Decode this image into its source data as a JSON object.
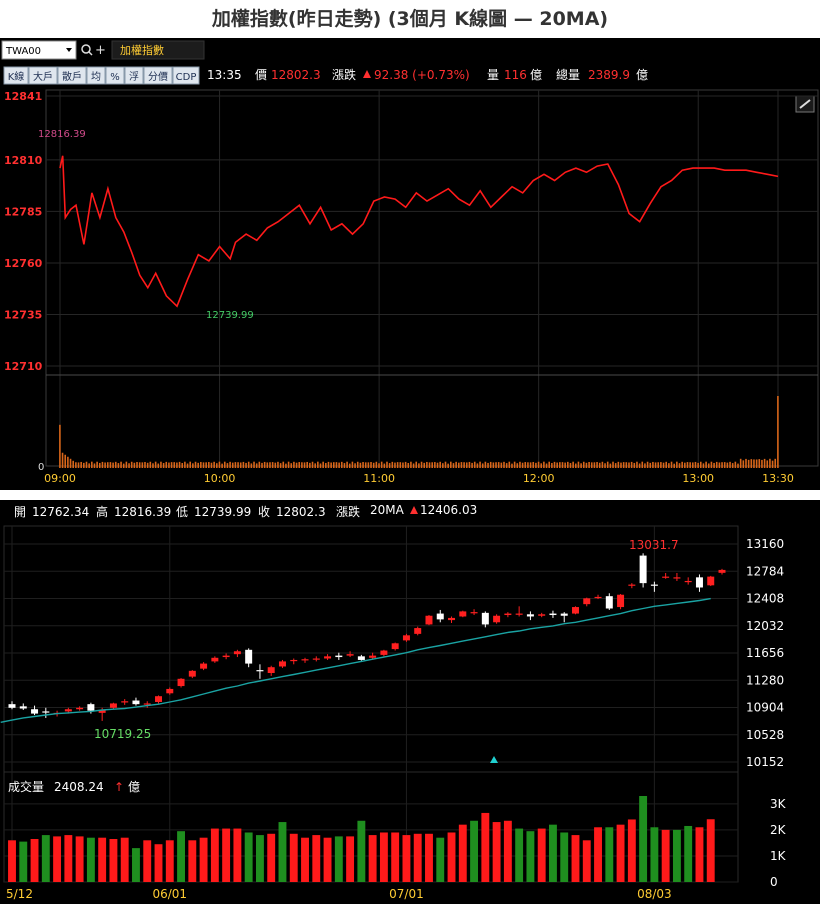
{
  "page_title": "加權指數(昨日走勢) (3個月 K線圖 — 20MA)",
  "intraday": {
    "symbol_value": "TWA00",
    "index_name": "加權指數",
    "toolbar_buttons": [
      "K線",
      "大戶",
      "散戶",
      "均",
      "%",
      "浮",
      "分價",
      "CDP"
    ],
    "time": "13:35",
    "price_label": "價",
    "price": "12802.3",
    "change_label": "漲跌",
    "change": "92.38 (+0.73%)",
    "volume_label": "量",
    "volume": "116",
    "volume_unit": "億",
    "total_label": "總量",
    "total": "2389.9",
    "total_unit": "億",
    "high_label": "12816.39",
    "low_label": "12739.99",
    "colors": {
      "line": "#ff1a1a",
      "volume": "#d9661a",
      "grid": "#2a2a2a",
      "up": "#ff2020"
    }
  },
  "kline": {
    "open_label": "開",
    "open": "12762.34",
    "high_label": "高",
    "high": "12816.39",
    "low_label": "低",
    "low": "12739.99",
    "close_label": "收",
    "close": "12802.3",
    "change_label": "漲跌",
    "ma_label": "20MA",
    "ma_value": "12406.03",
    "max_label": "13031.7",
    "min_label": "10719.25",
    "volume_title": "成交量",
    "volume_value": "2408.24",
    "volume_unit": "億",
    "colors": {
      "up": "#ff2020",
      "down": "#ffffff",
      "vol_up": "#ff1a1a",
      "vol_down": "#1f8f1f",
      "ma": "#1aa3a3"
    }
  },
  "chart_data": [
    {
      "type": "line",
      "title": "",
      "x_ticks": [
        "09:00",
        "10:00",
        "11:00",
        "12:00",
        "13:00",
        "13:30"
      ],
      "y_ticks": [
        12841,
        12810,
        12785,
        12760,
        12735,
        12710
      ],
      "ylim": [
        12710,
        12841
      ],
      "x_minutes": [
        0,
        1,
        2,
        4,
        6,
        9,
        12,
        15,
        18,
        21,
        24,
        27,
        30,
        33,
        36,
        40,
        44,
        48,
        52,
        56,
        60,
        64,
        66,
        70,
        74,
        78,
        82,
        86,
        90,
        94,
        98,
        102,
        106,
        110,
        114,
        118,
        122,
        126,
        130,
        134,
        138,
        142,
        146,
        150,
        154,
        158,
        162,
        166,
        170,
        174,
        178,
        182,
        186,
        190,
        194,
        198,
        202,
        206,
        210,
        214,
        218,
        222,
        226,
        230,
        234,
        238,
        242,
        246,
        250,
        254,
        258,
        262,
        266,
        270
      ],
      "y": [
        12806,
        12812,
        12782,
        12786,
        12788,
        12769,
        12794,
        12782,
        12796,
        12782,
        12775,
        12765,
        12754,
        12748,
        12755,
        12744,
        12739,
        12752,
        12764,
        12761,
        12768,
        12762,
        12770,
        12774,
        12771,
        12777,
        12780,
        12784,
        12788,
        12779,
        12787,
        12776,
        12779,
        12774,
        12779,
        12790,
        12792,
        12791,
        12787,
        12794,
        12790,
        12793,
        12796,
        12791,
        12788,
        12795,
        12787,
        12792,
        12797,
        12794,
        12800,
        12803,
        12800,
        12804,
        12806,
        12804,
        12807,
        12808,
        12798,
        12784,
        12780,
        12789,
        12797,
        12800,
        12805,
        12806,
        12806,
        12806,
        12805,
        12805,
        12805,
        12804,
        12803,
        12802
      ],
      "volume_first": 60,
      "volume_last": 100,
      "volume_typical": 8
    },
    {
      "type": "candlestick",
      "title": "",
      "x_ticks": [
        "5/12",
        "06/01",
        "07/01",
        "08/03"
      ],
      "y_ticks": [
        13160,
        12784,
        12408,
        12032,
        11656,
        11280,
        10904,
        10528,
        10152
      ],
      "ylim": [
        10050,
        13300
      ],
      "volume_ticks": [
        "3K",
        "2K",
        "1K",
        "0"
      ],
      "volume_max": 3300,
      "candles": [
        {
          "o": 10950,
          "h": 10990,
          "l": 10880,
          "c": 10900
        },
        {
          "o": 10920,
          "h": 10960,
          "l": 10870,
          "c": 10890
        },
        {
          "o": 10880,
          "h": 10930,
          "l": 10800,
          "c": 10820
        },
        {
          "o": 10850,
          "h": 10900,
          "l": 10760,
          "c": 10840
        },
        {
          "o": 10830,
          "h": 10860,
          "l": 10780,
          "c": 10830
        },
        {
          "o": 10850,
          "h": 10900,
          "l": 10820,
          "c": 10880
        },
        {
          "o": 10880,
          "h": 10920,
          "l": 10860,
          "c": 10900
        },
        {
          "o": 10950,
          "h": 10970,
          "l": 10820,
          "c": 10860
        },
        {
          "o": 10830,
          "h": 10900,
          "l": 10719,
          "c": 10870
        },
        {
          "o": 10900,
          "h": 10970,
          "l": 10880,
          "c": 10960
        },
        {
          "o": 10980,
          "h": 11020,
          "l": 10940,
          "c": 10990
        },
        {
          "o": 11000,
          "h": 11040,
          "l": 10930,
          "c": 10950
        },
        {
          "o": 10960,
          "h": 10990,
          "l": 10900,
          "c": 10960
        },
        {
          "o": 10980,
          "h": 11070,
          "l": 10960,
          "c": 11060
        },
        {
          "o": 11100,
          "h": 11180,
          "l": 11080,
          "c": 11160
        },
        {
          "o": 11200,
          "h": 11310,
          "l": 11180,
          "c": 11300
        },
        {
          "o": 11330,
          "h": 11420,
          "l": 11310,
          "c": 11410
        },
        {
          "o": 11440,
          "h": 11530,
          "l": 11420,
          "c": 11510
        },
        {
          "o": 11540,
          "h": 11610,
          "l": 11520,
          "c": 11590
        },
        {
          "o": 11600,
          "h": 11650,
          "l": 11570,
          "c": 11620
        },
        {
          "o": 11640,
          "h": 11700,
          "l": 11600,
          "c": 11680
        },
        {
          "o": 11700,
          "h": 11720,
          "l": 11460,
          "c": 11510
        },
        {
          "o": 11420,
          "h": 11500,
          "l": 11300,
          "c": 11410
        },
        {
          "o": 11380,
          "h": 11480,
          "l": 11340,
          "c": 11460
        },
        {
          "o": 11470,
          "h": 11560,
          "l": 11450,
          "c": 11540
        },
        {
          "o": 11550,
          "h": 11580,
          "l": 11500,
          "c": 11560
        },
        {
          "o": 11560,
          "h": 11590,
          "l": 11520,
          "c": 11570
        },
        {
          "o": 11570,
          "h": 11610,
          "l": 11540,
          "c": 11580
        },
        {
          "o": 11580,
          "h": 11640,
          "l": 11560,
          "c": 11610
        },
        {
          "o": 11620,
          "h": 11660,
          "l": 11560,
          "c": 11600
        },
        {
          "o": 11620,
          "h": 11680,
          "l": 11600,
          "c": 11640
        },
        {
          "o": 11610,
          "h": 11630,
          "l": 11550,
          "c": 11560
        },
        {
          "o": 11590,
          "h": 11660,
          "l": 11570,
          "c": 11620
        },
        {
          "o": 11630,
          "h": 11700,
          "l": 11610,
          "c": 11690
        },
        {
          "o": 11710,
          "h": 11800,
          "l": 11690,
          "c": 11790
        },
        {
          "o": 11830,
          "h": 11920,
          "l": 11810,
          "c": 11900
        },
        {
          "o": 11920,
          "h": 12020,
          "l": 11900,
          "c": 12000
        },
        {
          "o": 12050,
          "h": 12180,
          "l": 12040,
          "c": 12170
        },
        {
          "o": 12200,
          "h": 12250,
          "l": 12080,
          "c": 12120
        },
        {
          "o": 12110,
          "h": 12160,
          "l": 12070,
          "c": 12140
        },
        {
          "o": 12160,
          "h": 12240,
          "l": 12150,
          "c": 12230
        },
        {
          "o": 12220,
          "h": 12260,
          "l": 12180,
          "c": 12220
        },
        {
          "o": 12210,
          "h": 12230,
          "l": 12010,
          "c": 12050
        },
        {
          "o": 12080,
          "h": 12190,
          "l": 12060,
          "c": 12170
        },
        {
          "o": 12180,
          "h": 12220,
          "l": 12150,
          "c": 12200
        },
        {
          "o": 12200,
          "h": 12300,
          "l": 12160,
          "c": 12200
        },
        {
          "o": 12190,
          "h": 12230,
          "l": 12110,
          "c": 12160
        },
        {
          "o": 12170,
          "h": 12210,
          "l": 12150,
          "c": 12190
        },
        {
          "o": 12200,
          "h": 12240,
          "l": 12140,
          "c": 12180
        },
        {
          "o": 12200,
          "h": 12220,
          "l": 12080,
          "c": 12170
        },
        {
          "o": 12200,
          "h": 12300,
          "l": 12190,
          "c": 12290
        },
        {
          "o": 12330,
          "h": 12420,
          "l": 12300,
          "c": 12410
        },
        {
          "o": 12420,
          "h": 12460,
          "l": 12400,
          "c": 12430
        },
        {
          "o": 12440,
          "h": 12480,
          "l": 12250,
          "c": 12270
        },
        {
          "o": 12290,
          "h": 12470,
          "l": 12260,
          "c": 12460
        },
        {
          "o": 12590,
          "h": 12620,
          "l": 12550,
          "c": 12600
        },
        {
          "o": 13000,
          "h": 13031.7,
          "l": 12560,
          "c": 12620
        },
        {
          "o": 12600,
          "h": 12640,
          "l": 12500,
          "c": 12590
        },
        {
          "o": 12700,
          "h": 12760,
          "l": 12680,
          "c": 12710
        },
        {
          "o": 12700,
          "h": 12760,
          "l": 12650,
          "c": 12700
        },
        {
          "o": 12650,
          "h": 12700,
          "l": 12600,
          "c": 12650
        },
        {
          "o": 12700,
          "h": 12740,
          "l": 12500,
          "c": 12560
        },
        {
          "o": 12590,
          "h": 12720,
          "l": 12580,
          "c": 12710
        },
        {
          "o": 12762.34,
          "h": 12816.39,
          "l": 12739.99,
          "c": 12802.3
        }
      ],
      "ma20": [
        10700,
        10730,
        10760,
        10780,
        10800,
        10820,
        10830,
        10840,
        10850,
        10870,
        10880,
        10890,
        10910,
        10930,
        10950,
        10980,
        11010,
        11050,
        11090,
        11130,
        11170,
        11200,
        11240,
        11270,
        11300,
        11330,
        11360,
        11390,
        11420,
        11450,
        11480,
        11510,
        11540,
        11570,
        11600,
        11630,
        11660,
        11700,
        11730,
        11760,
        11790,
        11820,
        11850,
        11880,
        11910,
        11940,
        11960,
        11990,
        12010,
        12030,
        12060,
        12080,
        12110,
        12140,
        12170,
        12200,
        12240,
        12270,
        12300,
        12320,
        12340,
        12360,
        12380,
        12406.03
      ],
      "volumes": [
        1600,
        1550,
        1650,
        1800,
        1750,
        1800,
        1750,
        1700,
        1700,
        1650,
        1700,
        1300,
        1600,
        1450,
        1600,
        1950,
        1600,
        1700,
        2050,
        2050,
        2050,
        1900,
        1800,
        1850,
        2300,
        1850,
        1700,
        1800,
        1700,
        1750,
        1750,
        2350,
        1800,
        1900,
        1900,
        1800,
        1850,
        1850,
        1700,
        1900,
        2200,
        2350,
        2650,
        2300,
        2350,
        2050,
        1950,
        2050,
        2200,
        1900,
        1800,
        1600,
        2100,
        2100,
        2200,
        2400,
        3300,
        2100,
        2000,
        2000,
        2150,
        2100,
        2408.24
      ],
      "volume_up": [
        1,
        0,
        1,
        0,
        1,
        1,
        1,
        0,
        1,
        1,
        1,
        0,
        1,
        1,
        1,
        0,
        1,
        1,
        1,
        1,
        1,
        0,
        0,
        1,
        0,
        1,
        1,
        1,
        1,
        0,
        1,
        0,
        1,
        1,
        1,
        1,
        1,
        1,
        0,
        1,
        1,
        0,
        1,
        1,
        1,
        0,
        0,
        1,
        0,
        0,
        1,
        1,
        1,
        0,
        1,
        1,
        0,
        0,
        1,
        0,
        0,
        1,
        1
      ]
    }
  ]
}
